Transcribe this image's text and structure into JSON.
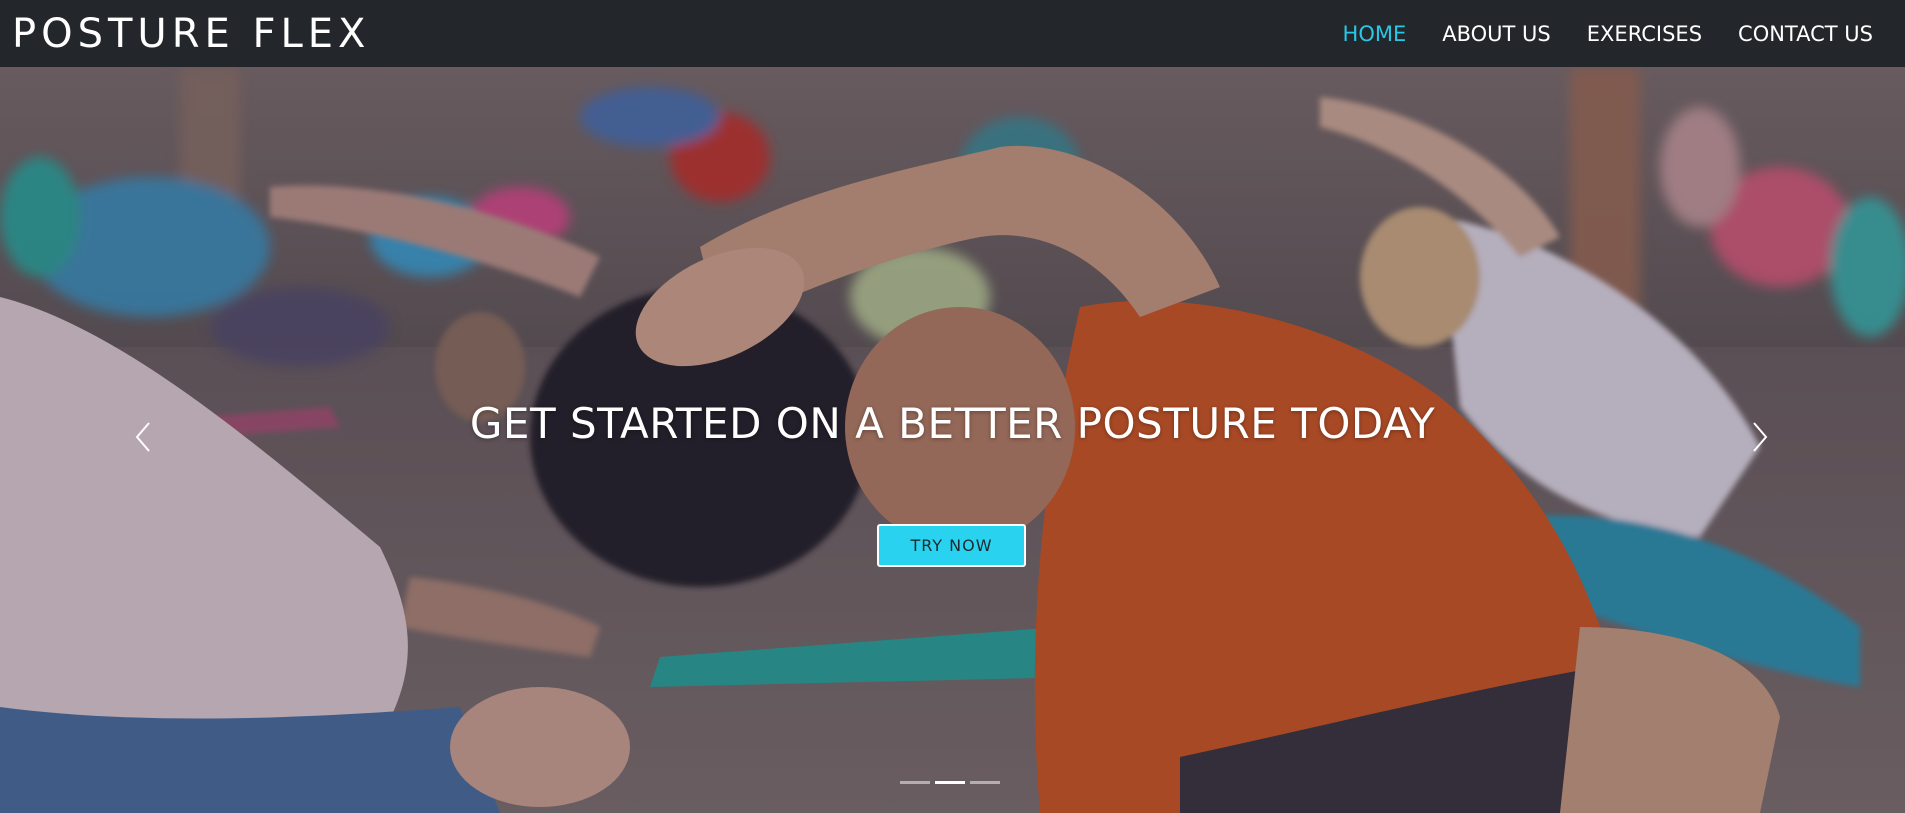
{
  "brand": "POSTURE FLEX",
  "nav": {
    "items": [
      {
        "label": "HOME",
        "active": true
      },
      {
        "label": "ABOUT US",
        "active": false
      },
      {
        "label": "EXERCISES",
        "active": false
      },
      {
        "label": "CONTACT US",
        "active": false
      }
    ]
  },
  "hero": {
    "heading": "GET STARTED ON A BETTER POSTURE TODAY",
    "cta_label": "TRY NOW",
    "prev_icon": "chevron-left-icon",
    "next_icon": "chevron-right-icon",
    "slides_total": 3,
    "active_slide": 2
  },
  "colors": {
    "navbar": "#23272b",
    "accent": "#29c7e6",
    "button": "#29d3ef"
  }
}
